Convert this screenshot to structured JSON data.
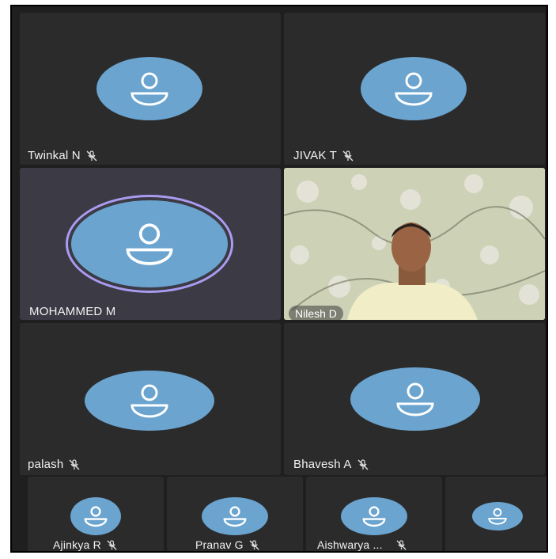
{
  "participants": {
    "twinkal": {
      "name": "Twinkal N",
      "muted": true
    },
    "jivak": {
      "name": "JIVAK T",
      "muted": true
    },
    "mohammed": {
      "name": "MOHAMMED M",
      "muted": false,
      "speaking": true
    },
    "nilesh": {
      "name": "Nilesh D",
      "video_on": true
    },
    "palash": {
      "name": "palash",
      "muted": true
    },
    "bhavesh": {
      "name": "Bhavesh A",
      "muted": true
    },
    "ajinkya": {
      "name": "Ajinkya R",
      "muted": true
    },
    "pranav": {
      "name": "Pranav G",
      "muted": true
    },
    "aishwarya": {
      "name": "Aishwarya ...",
      "muted": true
    },
    "unnamed": {
      "name": ""
    }
  },
  "colors": {
    "avatar": "#6aa4cf",
    "tile": "#2b2b2b",
    "active_tile": "#3b3a45",
    "speaking_ring": "#a99cf0"
  },
  "icons": {
    "avatar": "person-icon",
    "muted": "mic-off-icon"
  }
}
